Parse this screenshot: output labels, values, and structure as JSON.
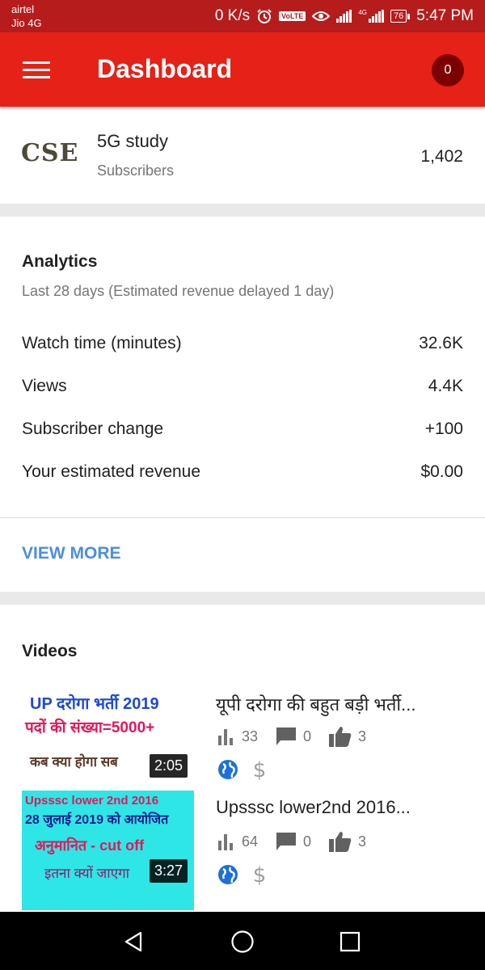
{
  "status_bar": {
    "carrier_1": "airtel",
    "carrier_2": "Jio 4G",
    "speed": "0 K/s",
    "volte": "VoLTE",
    "net_tag": "4G",
    "battery": "76",
    "time": "5:47 PM"
  },
  "app_bar": {
    "title": "Dashboard",
    "notification_count": "0"
  },
  "channel": {
    "logo_text": "CSE",
    "name": "5G study",
    "subscribers_label": "Subscribers",
    "subscribers_count": "1,402"
  },
  "analytics": {
    "title": "Analytics",
    "subtitle": "Last 28 days (Estimated revenue delayed 1 day)",
    "metrics": [
      {
        "label": "Watch time (minutes)",
        "value": "32.6K"
      },
      {
        "label": "Views",
        "value": "4.4K"
      },
      {
        "label": "Subscriber change",
        "value": "+100"
      },
      {
        "label": "Your estimated revenue",
        "value": "$0.00"
      }
    ],
    "view_more_label": "VIEW MORE"
  },
  "videos": {
    "title": "Videos",
    "items": [
      {
        "title": "यूपी दरोगा की बहुत बड़ी भर्ती...",
        "duration": "2:05",
        "views": "33",
        "comments": "0",
        "likes": "3",
        "thumb_lines": [
          "UP दरोगा भर्ती 2019",
          "पदों की संख्या=5000+",
          "कब क्या होगा सब"
        ]
      },
      {
        "title": "Upsssc lower2nd 2016...",
        "duration": "3:27",
        "views": "64",
        "comments": "0",
        "likes": "3",
        "thumb_lines": [
          "Upsssc lower 2nd 2016",
          "28 जुलाई 2019 को आयोजित",
          "अनुमानित  - cut off",
          "इतना क्यों जाएगा"
        ]
      }
    ]
  },
  "colors": {
    "status_bar": "#b71c1c",
    "app_bar": "#e62117",
    "badge": "#7d0000",
    "link": "#4a8fe2",
    "icon_blue": "#1e6fd9"
  },
  "icons": {
    "menu": "menu-icon",
    "alarm": "alarm-icon",
    "eye": "eye-icon",
    "signal": "signal-icon",
    "battery": "battery-icon",
    "views": "bar-chart-icon",
    "comments": "comment-icon",
    "likes": "thumbs-up-icon",
    "public": "globe-icon",
    "monetization": "dollar-icon",
    "nav_back": "back-triangle-icon",
    "nav_home": "home-circle-icon",
    "nav_recent": "recents-square-icon"
  }
}
